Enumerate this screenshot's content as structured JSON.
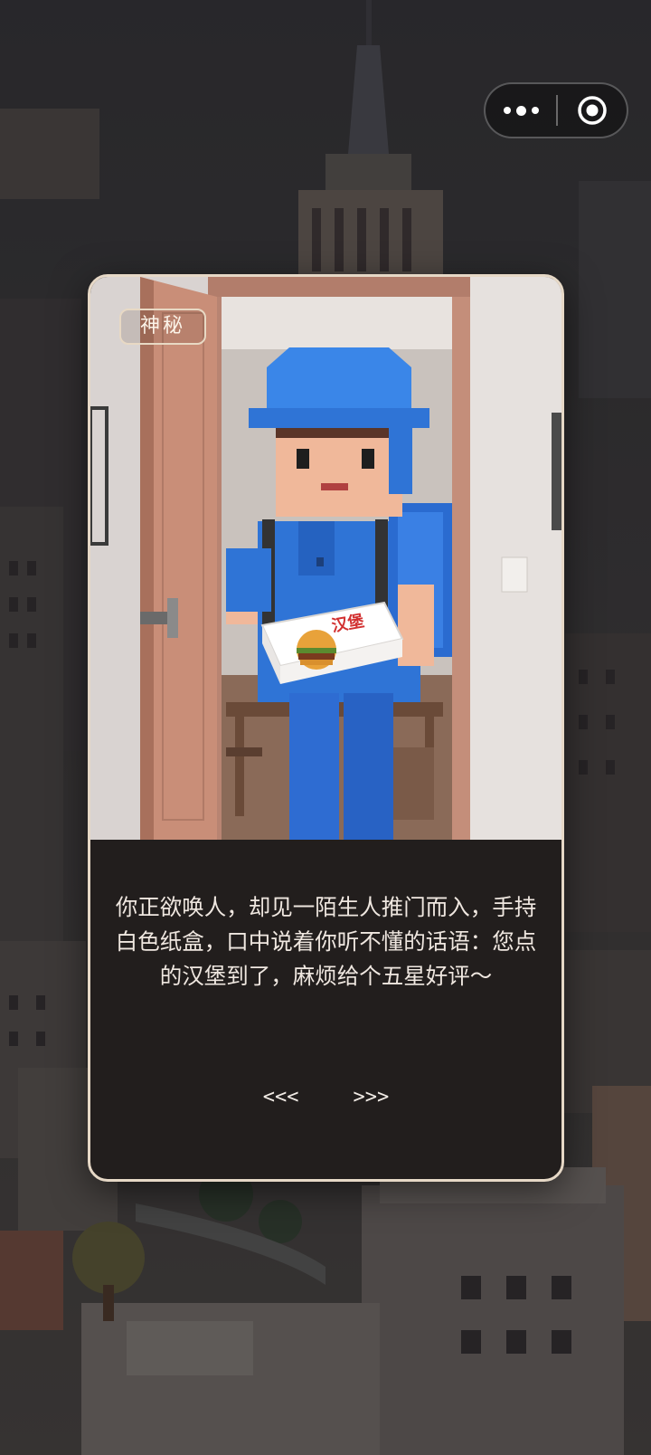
{
  "capsule": {
    "more_icon": "more-dots-icon",
    "close_icon": "target-close-icon"
  },
  "card": {
    "tag": "神秘",
    "story": "你正欲唤人，却见一陌生人推门而入，手持白色纸盒，口中说着你听不懂的话语：您点的汉堡到了，麻烦给个五星好评～",
    "box_label": "汉堡",
    "nav": {
      "prev": "<<<",
      "next": ">>>"
    }
  },
  "colors": {
    "card_border": "#e6d8c6",
    "card_bg": "#221e1d",
    "courier_blue": "#2f74d6",
    "door": "#c98e78"
  }
}
